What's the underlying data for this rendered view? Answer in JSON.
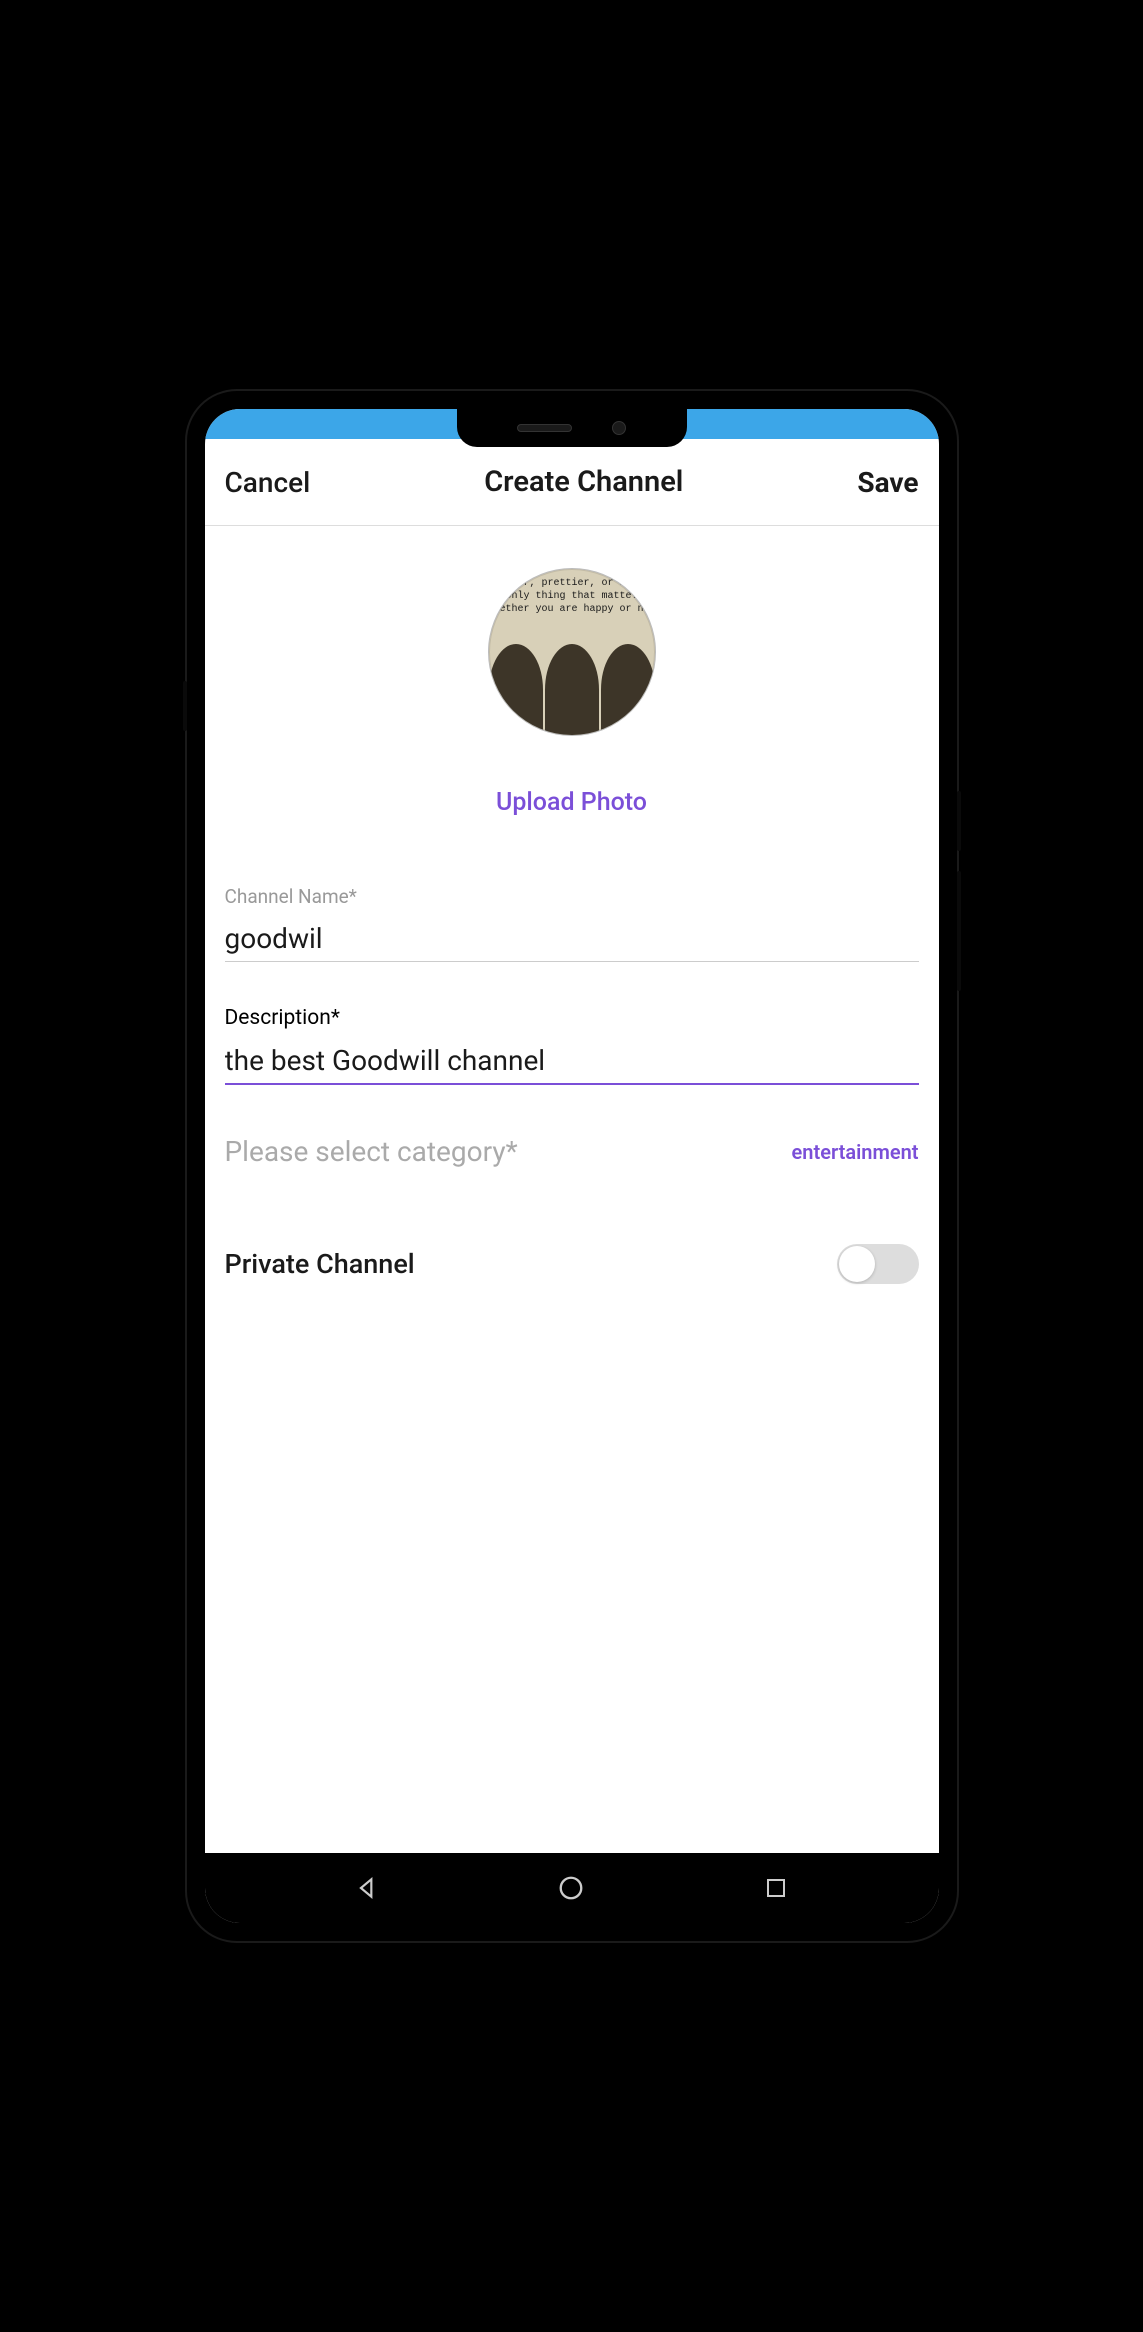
{
  "header": {
    "cancel": "Cancel",
    "title": "Create Channel",
    "save": "Save"
  },
  "photo": {
    "avatar_text_1": "er, prettier, or i",
    "avatar_text_2": "only thing that matte.",
    "avatar_text_3": "iether you are happy or ne",
    "upload_label": "Upload Photo"
  },
  "fields": {
    "name_label": "Channel Name*",
    "name_value": "goodwil",
    "description_label": "Description*",
    "description_value": "the best Goodwill channel"
  },
  "category": {
    "label": "Please select category*",
    "value": "entertainment"
  },
  "private": {
    "label": "Private Channel",
    "enabled": false
  }
}
